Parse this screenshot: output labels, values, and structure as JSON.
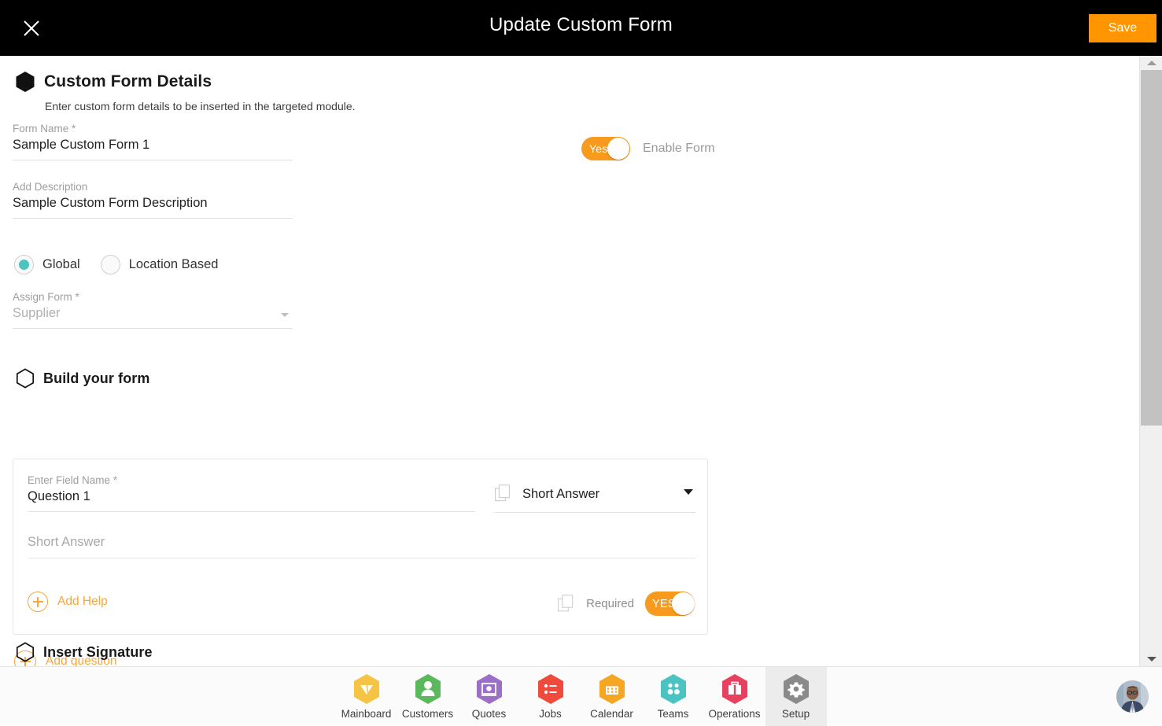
{
  "topbar": {
    "close_icon": "close-icon",
    "title": "Update Custom Form",
    "save_label": "Save"
  },
  "details_section": {
    "icon": "hexagon-filled-icon",
    "title": "Custom Form Details",
    "subtitle": "Enter custom form details to be inserted in the targeted module.",
    "form_name": {
      "label": "Form Name *",
      "value": "Sample Custom Form 1"
    },
    "description": {
      "label": "Add Description",
      "value": "Sample Custom Form Description"
    },
    "scope": {
      "options": [
        {
          "label": "Global",
          "selected": true
        },
        {
          "label": "Location Based",
          "selected": false
        }
      ]
    },
    "assign_form": {
      "label": "Assign Form *",
      "value": "Supplier",
      "is_placeholder": true
    },
    "enable_form": {
      "toggle_text": "Yes",
      "label": "Enable Form",
      "on": true
    }
  },
  "build_section": {
    "icon": "hexagon-outline-icon",
    "title": "Build your form",
    "question": {
      "field_name_label": "Enter Field Name *",
      "field_name_value": "Question 1",
      "type_icon": "copy-icon",
      "type_value": "Short Answer",
      "answer_placeholder": "Short Answer",
      "add_help_label": "Add Help",
      "required_icon": "copy-icon",
      "required_label": "Required",
      "required_toggle_text": "YES",
      "required_on": true
    },
    "add_question_label": "Add question"
  },
  "signature_section": {
    "icon": "hexagon-outline-icon",
    "title": "Insert Signature"
  },
  "bottom_nav": {
    "items": [
      {
        "label": "Mainboard",
        "icon": "mainboard-icon",
        "color": "#f6c445",
        "active": false
      },
      {
        "label": "Customers",
        "icon": "customers-icon",
        "color": "#5cb85c",
        "active": false
      },
      {
        "label": "Quotes",
        "icon": "quotes-icon",
        "color": "#9b6ec8",
        "active": false
      },
      {
        "label": "Jobs",
        "icon": "jobs-icon",
        "color": "#ee4b3c",
        "active": false
      },
      {
        "label": "Calendar",
        "icon": "calendar-icon",
        "color": "#f5a623",
        "active": false
      },
      {
        "label": "Teams",
        "icon": "teams-icon",
        "color": "#4cc3c3",
        "active": false
      },
      {
        "label": "Operations",
        "icon": "operations-icon",
        "color": "#e8415f",
        "active": false
      },
      {
        "label": "Setup",
        "icon": "gear-icon",
        "color": "#8a8a8a",
        "active": true
      }
    ],
    "avatar": "user-avatar"
  },
  "scrollbar": {
    "up_icon": "chevron-up-icon",
    "down_icon": "chevron-down-icon"
  },
  "colors": {
    "accent_orange": "#ff9500",
    "toggle_orange": "#f79a1e",
    "link_orange": "#f7a63a",
    "radio_teal": "#4dc3bd",
    "topbar_black": "#000000"
  }
}
